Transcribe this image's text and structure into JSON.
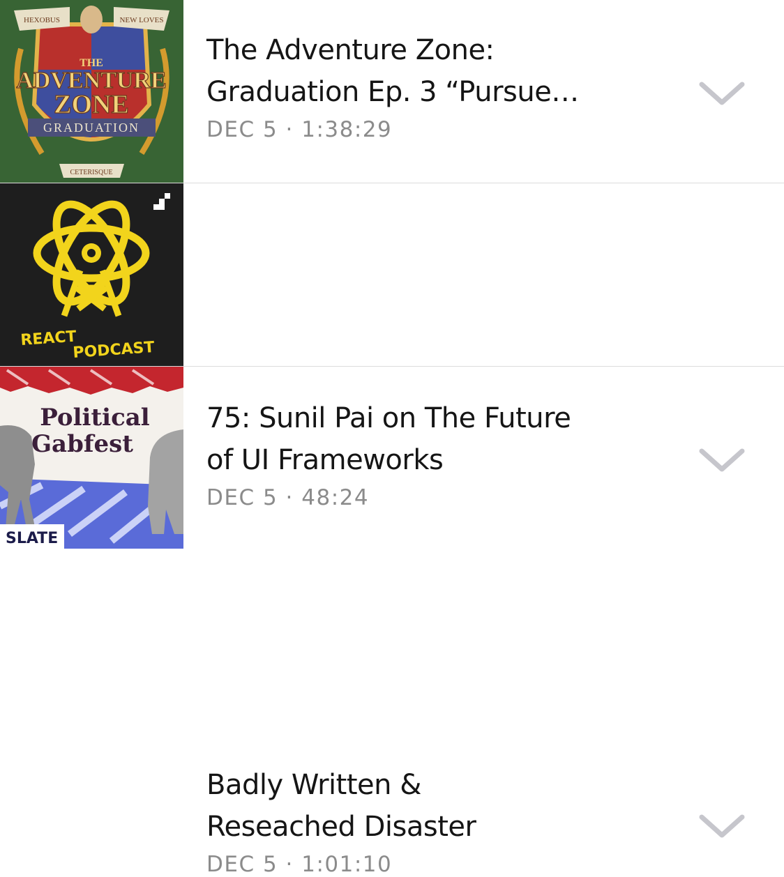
{
  "episodes": [
    {
      "title_line1": "The Adventure Zone:",
      "title_line2": "Graduation Ep. 3 “Pursue…",
      "meta": "DEC 5 · 1:38:29",
      "artwork": {
        "banner_left": "HEXOBUS",
        "banner_right": "NEW LOVES",
        "word1": "THE",
        "word2": "ADVENTURE",
        "word3": "ZONE",
        "word4": "GRADUATION",
        "motto": "CETERISQUE",
        "bg_color": "#3e6b3a"
      }
    },
    {
      "title_line1": "75: Sunil Pai on The Future",
      "title_line2": "of UI Frameworks",
      "meta": "DEC 5 · 48:24",
      "artwork": {
        "word1": "REACT",
        "word2": "PODCAST",
        "bg_color": "#1e1e1e",
        "accent": "#f2d41c"
      }
    },
    {
      "title_line1": "Badly Written &",
      "title_line2": "Reseached Disaster",
      "meta": "DEC 5 · 1:01:10",
      "artwork": {
        "word1": "Political",
        "word2": "Gabfest",
        "brand": "SLATE",
        "accent": "#3b3bd6"
      }
    }
  ]
}
